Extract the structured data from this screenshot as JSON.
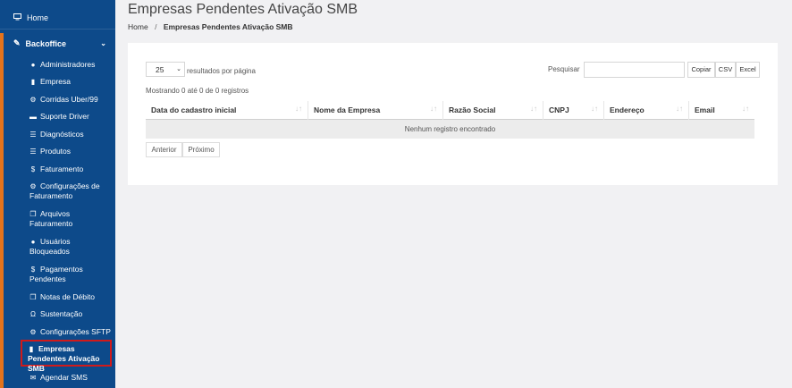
{
  "sidebar": {
    "home_label": "Home",
    "section_label": "Backoffice",
    "items": [
      {
        "label": "Administradores",
        "icon": "user-icon"
      },
      {
        "label": "Empresa",
        "icon": "building-icon"
      },
      {
        "label": "Corridas Uber/99",
        "icon": "cogs-icon"
      },
      {
        "label": "Suporte Driver",
        "icon": "car-icon"
      },
      {
        "label": "Diagnósticos",
        "icon": "list-icon"
      },
      {
        "label": "Produtos",
        "icon": "list-icon"
      },
      {
        "label": "Faturamento",
        "icon": "dollar-icon"
      },
      {
        "label": "Configurações de Faturamento",
        "icon": "cogs-icon"
      },
      {
        "label": "Arquivos Faturamento",
        "icon": "files-icon"
      },
      {
        "label": "Usuários Bloqueados",
        "icon": "user-icon"
      },
      {
        "label": "Pagamentos Pendentes",
        "icon": "dollar-icon"
      },
      {
        "label": "Notas de Débito",
        "icon": "files-icon"
      },
      {
        "label": "Sustentação",
        "icon": "headset-icon"
      },
      {
        "label": "Configurações SFTP",
        "icon": "cogs-icon"
      },
      {
        "label": "Empresas Pendentes Ativação SMB",
        "icon": "building-icon"
      },
      {
        "label": "Agendar SMS",
        "icon": "envelope-icon"
      }
    ],
    "highlighted_item_index": 14,
    "colors": {
      "background": "#0d4a8a",
      "accent": "#e3731c",
      "highlight_border": "#d11a1a"
    }
  },
  "header": {
    "title": "Empresas Pendentes Ativação SMB",
    "breadcrumb": {
      "home": "Home",
      "separator": "/",
      "current": "Empresas Pendentes Ativação SMB"
    }
  },
  "table_controls": {
    "page_length_value": "25",
    "page_length_label": "resultados por página",
    "search_label": "Pesquisar",
    "search_value": "",
    "export_buttons": [
      "Copiar",
      "CSV",
      "Excel"
    ],
    "info_text": "Mostrando 0 até 0 de 0 registros"
  },
  "table": {
    "columns": [
      "Data do cadastro inicial",
      "Nome da Empresa",
      "Razão Social",
      "CNPJ",
      "Endereço",
      "Email"
    ],
    "empty_message": "Nenhum registro encontrado"
  },
  "pagination": {
    "previous_label": "Anterior",
    "next_label": "Próximo"
  }
}
